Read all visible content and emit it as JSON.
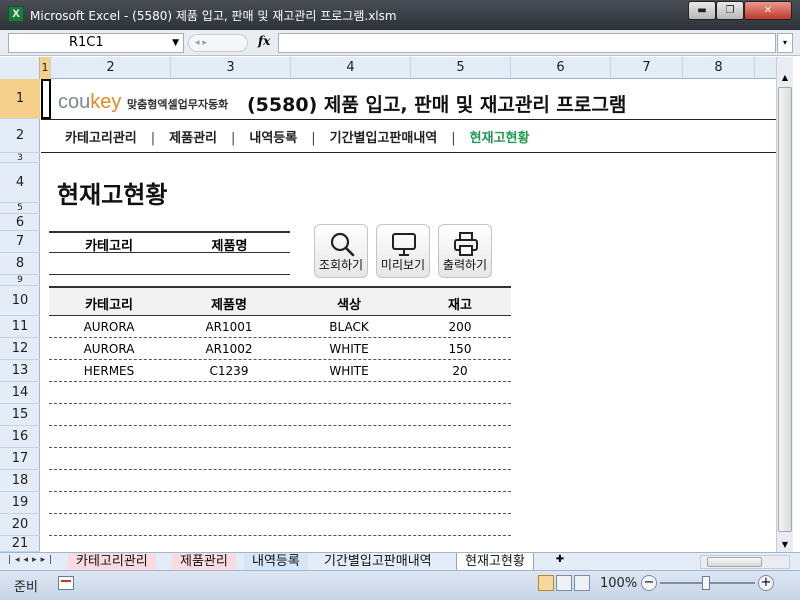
{
  "window": {
    "app_icon_text": "X",
    "title": "Microsoft Excel - (5580) 제품 입고, 판매 및 재고관리 프로그램.xlsm"
  },
  "formula_bar": {
    "name_box": "R1C1",
    "fx_label": "fx",
    "formula": ""
  },
  "columns": [
    "1",
    "2",
    "3",
    "4",
    "5",
    "6",
    "7",
    "8"
  ],
  "rows": [
    "1",
    "2",
    "3",
    "4",
    "5",
    "6",
    "7",
    "8",
    "9",
    "10",
    "11",
    "12",
    "13",
    "14",
    "15",
    "16",
    "17",
    "18",
    "19",
    "20",
    "21"
  ],
  "header": {
    "logo_main": "cou",
    "logo_key": "key",
    "logo_tagline": "맞춤형엑셀업무자동화",
    "title": "(5580) 제품 입고, 판매 및 재고관리 프로그램"
  },
  "nav": [
    {
      "label": "카테고리관리",
      "active": false
    },
    {
      "label": "제품관리",
      "active": false
    },
    {
      "label": "내역등록",
      "active": false
    },
    {
      "label": "기간별입고판매내역",
      "active": false
    },
    {
      "label": "현재고현황",
      "active": true
    }
  ],
  "section_title": "현재고현황",
  "search": {
    "category_label": "카테고리",
    "product_label": "제품명",
    "category_value": "",
    "product_value": ""
  },
  "buttons": {
    "search": "조회하기",
    "preview": "미리보기",
    "print": "출력하기"
  },
  "table": {
    "headers": [
      "카테고리",
      "제품명",
      "색상",
      "재고"
    ],
    "rows": [
      [
        "AURORA",
        "AR1001",
        "BLACK",
        "200"
      ],
      [
        "AURORA",
        "AR1002",
        "WHITE",
        "150"
      ],
      [
        "HERMES",
        "C1239",
        "WHITE",
        "20"
      ],
      [
        "",
        "",
        "",
        ""
      ],
      [
        "",
        "",
        "",
        ""
      ],
      [
        "",
        "",
        "",
        ""
      ],
      [
        "",
        "",
        "",
        ""
      ],
      [
        "",
        "",
        "",
        ""
      ],
      [
        "",
        "",
        "",
        ""
      ],
      [
        "",
        "",
        "",
        ""
      ]
    ]
  },
  "sheet_tabs": [
    "카테고리관리",
    "제품관리",
    "내역등록",
    "기간별입고판매내역",
    "현재고현황"
  ],
  "active_sheet": "현재고현황",
  "status": {
    "ready": "준비",
    "zoom": "100%"
  },
  "colors": {
    "nav_active": "#1e9a50",
    "logo_key": "#e58a1f",
    "logo_main": "#7a8a8f"
  }
}
